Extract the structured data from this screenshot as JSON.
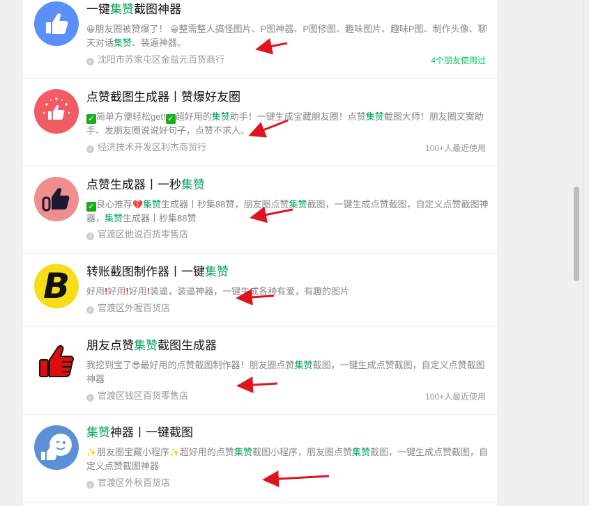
{
  "items": [
    {
      "title_pre": "一键",
      "title_hl": "集赞",
      "title_post": "截图神器",
      "desc": {
        "e1": "😀",
        "a": "朋友圈被赞爆了！",
        "e2": "😀",
        "b": "整需整人搞怪图片、P图神器、P图修图、趣味图片、趣味P图、制作头像、聊天对话",
        "hl": "集赞",
        "c": "、装逼神器。"
      },
      "location": "沈阳市苏家屯区金益元百货商行",
      "usage": "4个朋友使用过",
      "avatar_icon": "thumbs-up-icon",
      "avatar_color": "#5b8ff9"
    },
    {
      "title": "点赞截图生成器丨赞爆好友圈",
      "desc": {
        "c1": "✓",
        "a": "简单方便轻松get!",
        "c2": "✓",
        "b": "超好用的",
        "hl1": "集赞",
        "c": "助手！一键生成宝藏朋友圈！点赞",
        "hl2": "集赞",
        "d": "截图大师！朋友圈文案助手、发朋友圈说说好句子，点赞不求人。"
      },
      "location": "经济技术开发区利杰商贸行",
      "usage": "100+人最近使用",
      "avatar_icon": "sparkle-thumbs-up-icon",
      "avatar_color": "#f25a64"
    },
    {
      "title_pre": "点赞生成器丨一秒",
      "title_hl": "集赞",
      "desc": {
        "c1": "✓",
        "a": "良心推荐",
        "e1": "💔",
        "hl1": "集赞",
        "b": "生成器丨秒集88赞，朋友圈点赞",
        "hl2": "集赞",
        "c": "截图，一键生成点赞截图，自定义点赞截图神器，",
        "hl3": "集赞",
        "d": "生成器丨秒集88赞"
      },
      "location": "官渡区他说百货零售店",
      "avatar_icon": "thumbs-up-dark-icon",
      "avatar_color": "#ee8e8e"
    },
    {
      "title_pre": "转账截图制作器丨一键",
      "title_hl": "集赞",
      "desc": {
        "a": "好用",
        "x1": "!",
        "b": "好用",
        "x2": "!",
        "c": "好用",
        "x3": "!",
        "d": "装逼，装逼神器，一键生成各种有爱，有趣的图片"
      },
      "location": "官渡区外喔百货店",
      "avatar_icon": "letter-b-icon",
      "avatar_letter": "B",
      "avatar_color": "#f7dd18"
    },
    {
      "title_pre": "朋友点赞",
      "title_hl": "集赞",
      "title_post": "截图生成器",
      "desc": {
        "a": "我挖到宝了",
        "e1": "😎",
        "b": "最好用的点赞截图制作器！朋友圈点赞",
        "hl": "集赞",
        "c": "截图，一键生成点赞截图，自定义点赞截图神器"
      },
      "location": "官渡区钱区百货零售店",
      "usage": "100+人最近使用",
      "avatar_icon": "red-thumbs-up-icon",
      "avatar_color": "#ffffff"
    },
    {
      "title_hl": "集赞",
      "title_post": "神器丨一键截图",
      "desc": {
        "e1": "✨",
        "a": "朋友圈宝藏小程序",
        "e2": "✨",
        "b": "超好用的点赞",
        "hl1": "集赞",
        "c": "截图小程序，朋友圈点赞",
        "hl2": "集赞",
        "d": "截图，一键生成点赞截图，自定义点赞截图神器"
      },
      "location": "官渡区外秋百货店",
      "avatar_icon": "wink-thumbs-up-icon",
      "avatar_color": "#5b8fd6"
    }
  ],
  "colors": {
    "highlight": "#07a35a",
    "usage_green": "#07c160",
    "arrow": "#e0141e"
  }
}
